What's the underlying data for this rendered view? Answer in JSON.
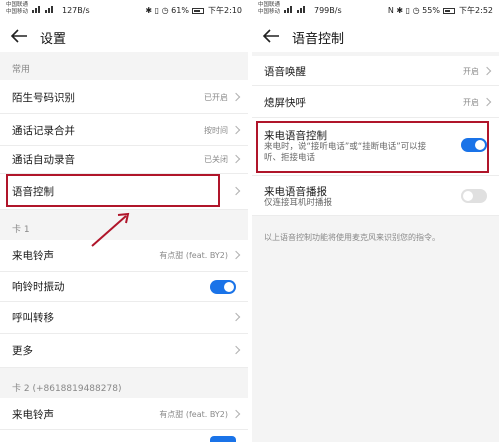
{
  "left": {
    "status": {
      "carrier1": "中国联通",
      "carrier2": "中国移动",
      "net_speed": "127B/s",
      "battery_pct": "61%",
      "time": "下午2:10"
    },
    "title": "设置",
    "sections": {
      "common": "常用",
      "card1": "卡 1",
      "card2": "卡 2 (+8618819488278)"
    },
    "rows": {
      "stranger_id": {
        "label": "陌生号码识别",
        "value": "已开启"
      },
      "call_log_merge": {
        "label": "通话记录合并",
        "value": "按时间"
      },
      "auto_record": {
        "label": "通话自动录音",
        "value": "已关闭"
      },
      "voice_control": {
        "label": "语音控制"
      },
      "ringtone1": {
        "label": "来电铃声",
        "value": "有点甜 (feat. BY2)"
      },
      "vibrate": {
        "label": "响铃时振动",
        "on": true
      },
      "forwarding": {
        "label": "呼叫转移"
      },
      "more": {
        "label": "更多"
      },
      "ringtone2": {
        "label": "来电铃声",
        "value": "有点甜 (feat. BY2)"
      }
    }
  },
  "right": {
    "status": {
      "carrier1": "中国联通",
      "carrier2": "中国移动",
      "net_speed": "799B/s",
      "battery_pct": "55%",
      "time": "下午2:52"
    },
    "title": "语音控制",
    "rows": {
      "voice_wake": {
        "label": "语音唤醒",
        "value": "开启"
      },
      "screen_off": {
        "label": "熄屏快呼",
        "value": "开启"
      },
      "incoming_voice": {
        "label": "来电语音控制",
        "sub1": "来电时，说“接听电话”或“挂断电话”可以接",
        "sub2": "听、拒接电话",
        "on": true
      },
      "incoming_announce": {
        "label": "来电语音播报",
        "sub1": "仅连接耳机时播报",
        "on": false
      }
    },
    "footer": "以上语音控制功能将使用麦克风来识别您的指令。"
  },
  "colors": {
    "accent": "#1a73e8",
    "highlight": "#b0152a"
  }
}
